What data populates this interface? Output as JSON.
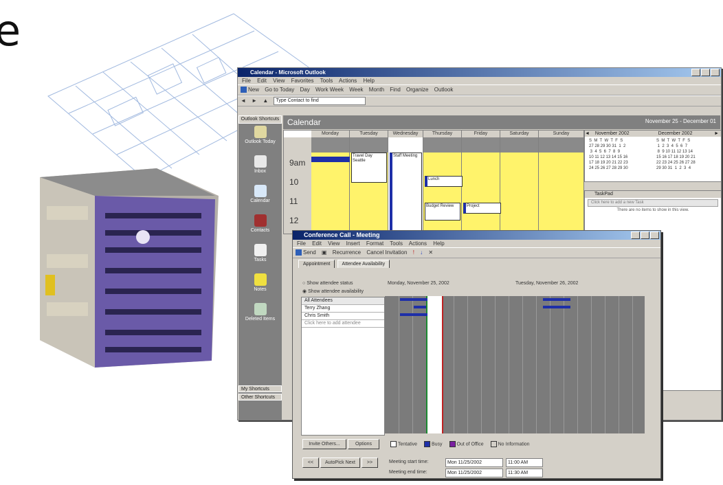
{
  "big_letter": "e",
  "outlook": {
    "title": "Calendar - Microsoft Outlook",
    "menu": [
      "File",
      "Edit",
      "View",
      "Favorites",
      "Tools",
      "Actions",
      "Help"
    ],
    "toolbar1": [
      "New",
      "Go to Today",
      "Day",
      "Work Week",
      "Week",
      "Month",
      "Find",
      "Organize",
      "Outlook"
    ],
    "toolbar2_field": "Type Contact to find",
    "outlook_shortcuts_title": "Outlook Shortcuts",
    "shortcuts": [
      "Outlook Today",
      "Inbox",
      "Calendar",
      "Contacts",
      "Tasks",
      "Notes",
      "Deleted Items"
    ],
    "bottom_groups": [
      "My Shortcuts",
      "Other Shortcuts"
    ],
    "calendar_title": "Calendar",
    "date_range": "November 25 - December 01",
    "days": [
      "Monday",
      "Tuesday",
      "Wednesday",
      "Thursday",
      "Friday",
      "Saturday",
      "Sunday"
    ],
    "times": [
      "9am",
      "10",
      "11",
      "12"
    ],
    "appointments": [
      {
        "text": "Travel Day Seattle"
      },
      {
        "text": "Staff Meeting"
      },
      {
        "text": "Lunch"
      },
      {
        "text": "Budget Review"
      },
      {
        "text": "Project"
      }
    ],
    "month1_title": "November 2002",
    "month2_title": "December 2002",
    "taskpad_title": "TaskPad",
    "taskpad_new": "Click here to add a new Task",
    "taskpad_empty": "There are no items to show in this view."
  },
  "meeting": {
    "title": "Conference Call - Meeting",
    "menu": [
      "File",
      "Edit",
      "View",
      "Insert",
      "Format",
      "Tools",
      "Actions",
      "Help"
    ],
    "toolbar": [
      "Send",
      "Recurrence",
      "Cancel Invitation"
    ],
    "tabs": [
      "Appointment",
      "Attendee Availability"
    ],
    "option1": "Show attendee status",
    "option2": "Show attendee availability",
    "attendees": [
      "All Attendees",
      "Terry Zhang",
      "Chris Smith",
      "Click here to add attendee"
    ],
    "day1_header": "Monday, November 25, 2002",
    "day2_header": "Tuesday, November 26, 2002",
    "legend": [
      "Tentative",
      "Busy",
      "Out of Office",
      "No Information"
    ],
    "invite_button": "Invite Others...",
    "options_button": "Options",
    "autopick_back": "<<",
    "autopick_label": "AutoPick Next",
    "autopick_fwd": ">>",
    "start_label": "Meeting start time:",
    "end_label": "Meeting end time:",
    "start_date": "Mon 11/25/2002",
    "start_time": "11:00 AM",
    "end_date": "Mon 11/25/2002",
    "end_time": "11:30 AM"
  },
  "colors": {
    "titlebar": "#0a246a",
    "calendar_yellow": "#fff36b",
    "busy_blue": "#1e2fa8",
    "oof_purple": "#7a1fa0"
  }
}
